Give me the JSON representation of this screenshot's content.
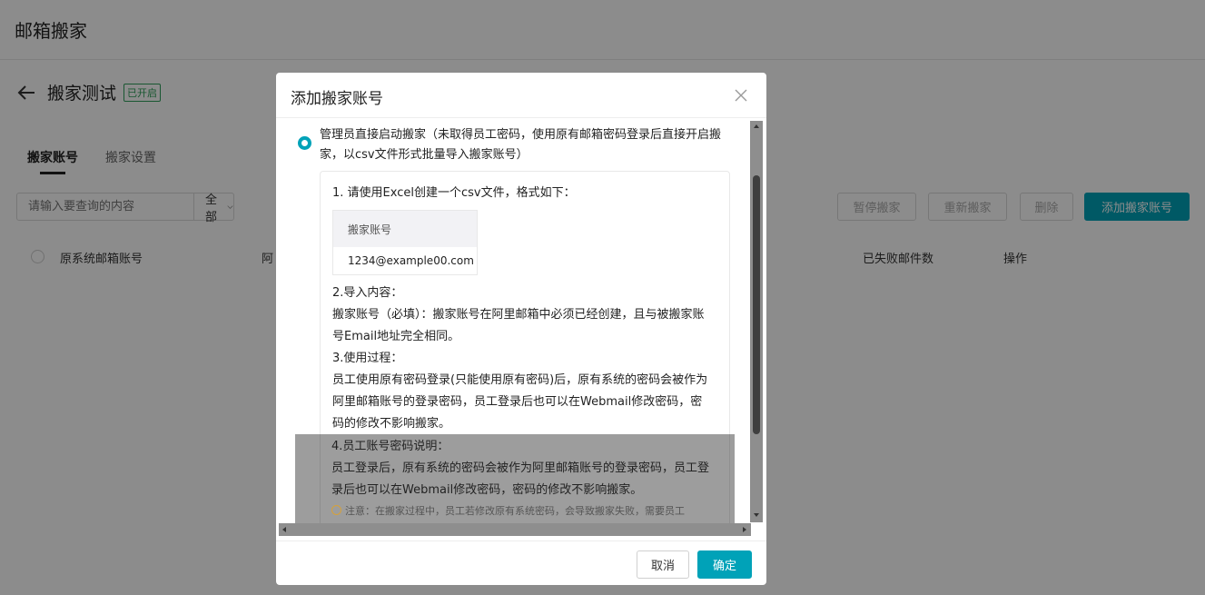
{
  "page": {
    "title": "邮箱搬家",
    "sub_title": "搬家测试",
    "status_badge": "已开启",
    "tabs": [
      "搬家账号",
      "搬家设置"
    ],
    "search_placeholder": "请输入要查询的内容",
    "search_select": "全部",
    "toolbar": {
      "pause": "暂停搬家",
      "restart": "重新搬家",
      "delete": "删除",
      "add": "添加搬家账号"
    },
    "table_headers": {
      "source_account": "原系统邮箱账号",
      "col2": "阿",
      "failed_count": "已失败邮件数",
      "actions": "操作"
    }
  },
  "modal": {
    "title": "添加搬家账号",
    "radio_label": "管理员直接启动搬家（未取得员工密码，使用原有邮箱密码登录后直接开启搬家，以csv文件形式批量导入搬家账号）",
    "step1": "1. 请使用Excel创建一个csv文件，格式如下：",
    "sample_header": "搬家账号",
    "sample_value": "1234@example00.com",
    "step2_title": "2.导入内容：",
    "step2_text": "搬家账号（必填）：搬家账号在阿里邮箱中必须已经创建，且与被搬家账号Email地址完全相同。",
    "step3_title": "3.使用过程：",
    "step3_text": "员工使用原有密码登录(只能使用原有密码)后，原有系统的密码会被作为阿里邮箱账号的登录密码，员工登录后也可以在Webmail修改密码，密码的修改不影响搬家。",
    "step4_title": "4.员工账号密码说明：",
    "step4_text": "员工登录后，原有系统的密码会被作为阿里邮箱账号的登录密码，员工登录后也可以在Webmail修改密码，密码的修改不影响搬家。",
    "warning": "注意：在搬家过程中，员工若修改原有系统密码，会导致搬家失败，需要员工",
    "cancel": "取消",
    "ok": "确定"
  },
  "colors": {
    "accent": "#00a2b8",
    "badge": "#2f9e5a"
  }
}
